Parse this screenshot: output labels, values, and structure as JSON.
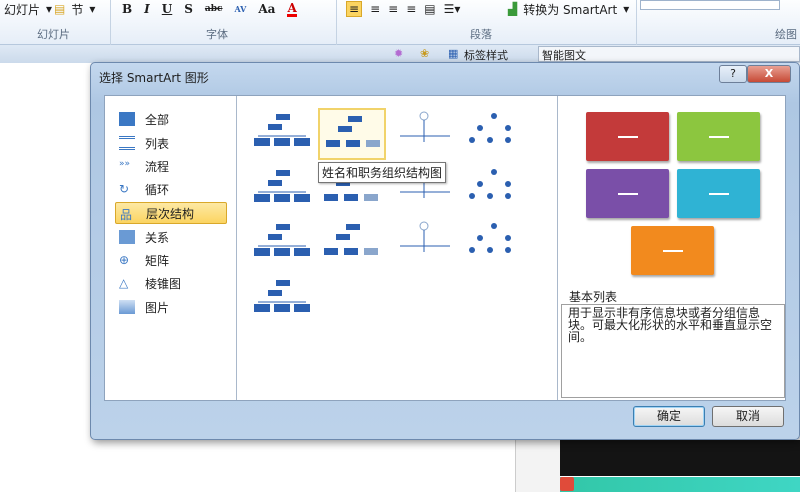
{
  "ribbon": {
    "slides_btn": "幻灯片",
    "section_btn": "节",
    "groups": {
      "slides": "幻灯片",
      "font": "字体",
      "paragraph": "段落",
      "drawing": "绘图"
    },
    "font_buttons": [
      "B",
      "I",
      "U",
      "S",
      "abc",
      "AV",
      "Aa",
      "A"
    ],
    "convert_smartart": "转换为 SmartArt"
  },
  "toolbar2": {
    "tag_style": "标签样式",
    "smart_text": "智能图文"
  },
  "dialog": {
    "title": "选择 SmartArt 图形",
    "help": "?",
    "close": "X",
    "categories": [
      {
        "label": "全部",
        "icon": "all-icon"
      },
      {
        "label": "列表",
        "icon": "list-icon"
      },
      {
        "label": "流程",
        "icon": "process-icon"
      },
      {
        "label": "循环",
        "icon": "cycle-icon"
      },
      {
        "label": "层次结构",
        "icon": "hierarchy-icon",
        "selected": true
      },
      {
        "label": "关系",
        "icon": "relationship-icon"
      },
      {
        "label": "矩阵",
        "icon": "matrix-icon"
      },
      {
        "label": "棱锥图",
        "icon": "pyramid-icon"
      },
      {
        "label": "图片",
        "icon": "picture-icon"
      }
    ],
    "tooltip": "姓名和职务组织结构图",
    "preview": {
      "name": "基本列表",
      "description": "用于显示非有序信息块或者分组信息块。可最大化形状的水平和垂直显示空间。",
      "colors": [
        "#c33a3a",
        "#8cc63f",
        "#7a4fa8",
        "#2fb3d4",
        "#f28a1e"
      ]
    },
    "ok": "确定",
    "cancel": "取消"
  }
}
